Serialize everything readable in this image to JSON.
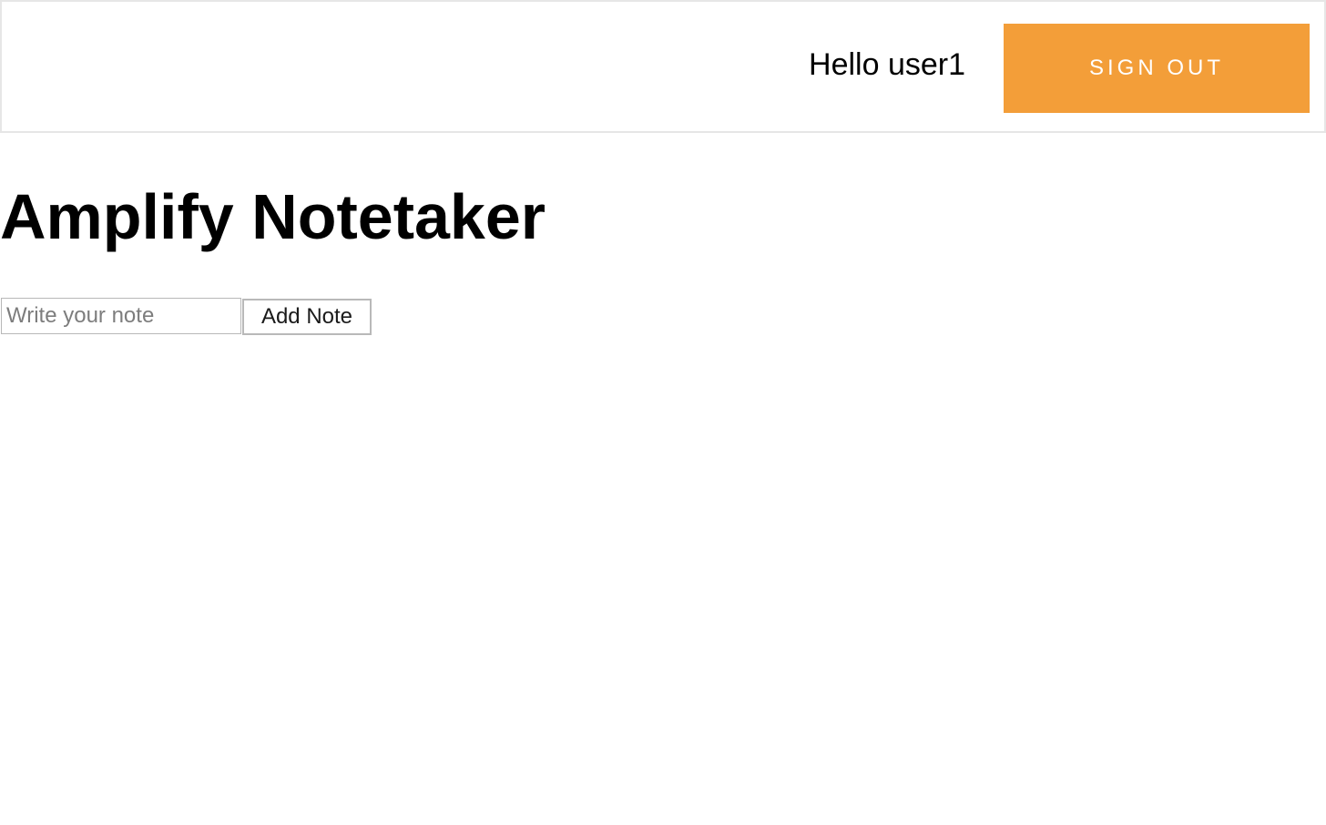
{
  "header": {
    "greeting": "Hello user1",
    "sign_out_label": "SIGN OUT",
    "sign_out_color": "#f39e39"
  },
  "main": {
    "title": "Amplify Notetaker",
    "note_input": {
      "value": "",
      "placeholder": "Write your note"
    },
    "add_note_label": "Add Note"
  }
}
